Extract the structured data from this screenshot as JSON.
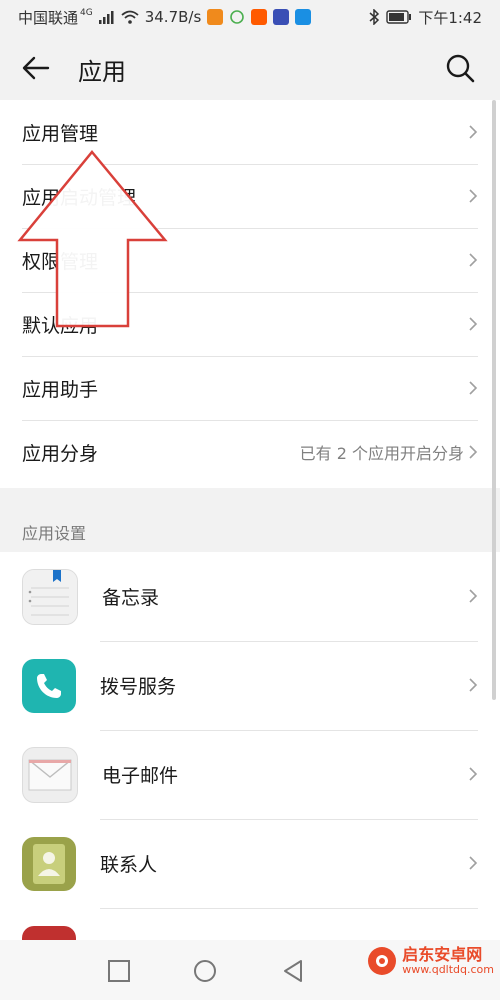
{
  "status_bar": {
    "carrier": "中国联通",
    "network_type": "4G",
    "speed": "34.7B/s",
    "time": "下午1:42"
  },
  "header": {
    "title": "应用",
    "back_icon": "arrow-left-icon",
    "search_icon": "search-icon"
  },
  "main_list": [
    {
      "label": "应用管理",
      "value": ""
    },
    {
      "label": "应用启动管理",
      "value": ""
    },
    {
      "label": "权限管理",
      "value": ""
    },
    {
      "label": "默认应用",
      "value": ""
    },
    {
      "label": "应用助手",
      "value": ""
    },
    {
      "label": "应用分身",
      "value": "已有 2 个应用开启分身"
    }
  ],
  "settings_section": {
    "header": "应用设置",
    "apps": [
      {
        "name": "备忘录",
        "icon": "notepad-icon"
      },
      {
        "name": "拨号服务",
        "icon": "phone-icon"
      },
      {
        "name": "电子邮件",
        "icon": "envelope-icon"
      },
      {
        "name": "联系人",
        "icon": "contact-icon"
      }
    ]
  },
  "watermark": {
    "title": "启东安卓网",
    "url": "www.qdltdq.com"
  },
  "colors": {
    "arrow": "#d9403a",
    "phone_app": "#1fb5b0",
    "contacts_app": "#9aa24a",
    "notepad_bookmark": "#1b72c9"
  }
}
